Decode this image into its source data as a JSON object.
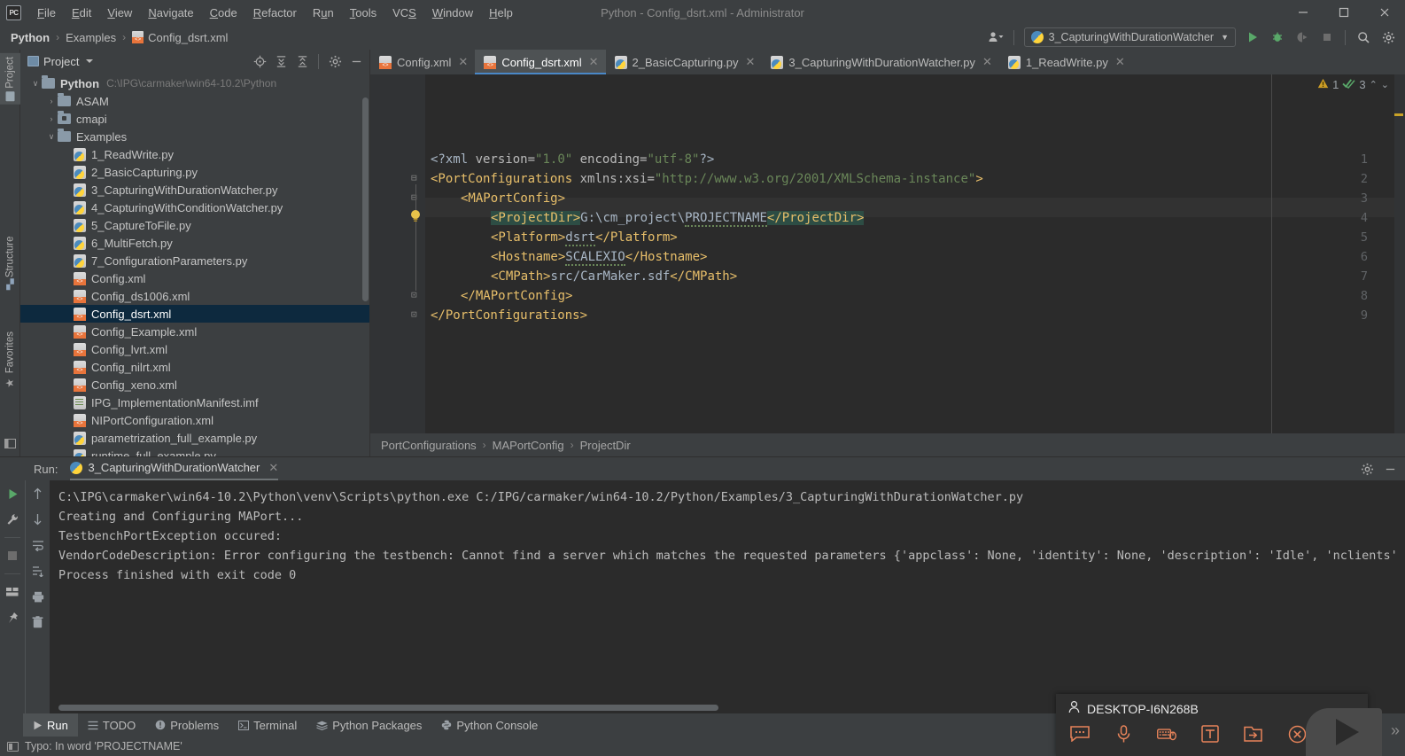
{
  "titlebar": {
    "app_badge": "PC",
    "menus": [
      "File",
      "Edit",
      "View",
      "Navigate",
      "Code",
      "Refactor",
      "Run",
      "Tools",
      "VCS",
      "Window",
      "Help"
    ],
    "window_title": "Python - Config_dsrt.xml - Administrator",
    "minimize": "—",
    "maximize": "☐",
    "close": "✕"
  },
  "navbar": {
    "crumbs": [
      "Python",
      "Examples",
      "Config_dsrt.xml"
    ],
    "separator": "›",
    "run_config": "3_CapturingWithDurationWatcher",
    "profile_icon": "user-profile-icon",
    "run_icon": "run-icon",
    "debug_icon": "debug-icon",
    "coverage_icon": "run-coverage-icon",
    "stop_icon": "stop-icon",
    "search_icon": "search-everywhere-icon",
    "settings_icon": "settings-gear-icon"
  },
  "left_strip": {
    "project": "Project",
    "structure": "Structure",
    "favorites": "Favorites"
  },
  "project_panel": {
    "title": "Project",
    "icons": [
      "locate-icon",
      "expand-all-icon",
      "collapse-all-icon",
      "settings-gear-icon",
      "hide-icon"
    ],
    "tree": [
      {
        "label": "Python",
        "path": "C:\\IPG\\carmaker\\win64-10.2\\Python",
        "type": "folder",
        "indent": 0,
        "arrow": "∨",
        "bold": true,
        "selected": false
      },
      {
        "label": "ASAM",
        "path": "",
        "type": "folder",
        "indent": 1,
        "arrow": "›",
        "bold": false,
        "selected": false
      },
      {
        "label": "cmapi",
        "path": "",
        "type": "folder-module",
        "indent": 1,
        "arrow": "›",
        "bold": false,
        "selected": false
      },
      {
        "label": "Examples",
        "path": "",
        "type": "folder",
        "indent": 1,
        "arrow": "∨",
        "bold": false,
        "selected": false
      },
      {
        "label": "1_ReadWrite.py",
        "path": "",
        "type": "py",
        "indent": 2,
        "arrow": "",
        "bold": false,
        "selected": false
      },
      {
        "label": "2_BasicCapturing.py",
        "path": "",
        "type": "py",
        "indent": 2,
        "arrow": "",
        "bold": false,
        "selected": false
      },
      {
        "label": "3_CapturingWithDurationWatcher.py",
        "path": "",
        "type": "py",
        "indent": 2,
        "arrow": "",
        "bold": false,
        "selected": false
      },
      {
        "label": "4_CapturingWithConditionWatcher.py",
        "path": "",
        "type": "py",
        "indent": 2,
        "arrow": "",
        "bold": false,
        "selected": false
      },
      {
        "label": "5_CaptureToFile.py",
        "path": "",
        "type": "py",
        "indent": 2,
        "arrow": "",
        "bold": false,
        "selected": false
      },
      {
        "label": "6_MultiFetch.py",
        "path": "",
        "type": "py",
        "indent": 2,
        "arrow": "",
        "bold": false,
        "selected": false
      },
      {
        "label": "7_ConfigurationParameters.py",
        "path": "",
        "type": "py",
        "indent": 2,
        "arrow": "",
        "bold": false,
        "selected": false
      },
      {
        "label": "Config.xml",
        "path": "",
        "type": "xml",
        "indent": 2,
        "arrow": "",
        "bold": false,
        "selected": false
      },
      {
        "label": "Config_ds1006.xml",
        "path": "",
        "type": "xml",
        "indent": 2,
        "arrow": "",
        "bold": false,
        "selected": false
      },
      {
        "label": "Config_dsrt.xml",
        "path": "",
        "type": "xml",
        "indent": 2,
        "arrow": "",
        "bold": false,
        "selected": true
      },
      {
        "label": "Config_Example.xml",
        "path": "",
        "type": "xml",
        "indent": 2,
        "arrow": "",
        "bold": false,
        "selected": false
      },
      {
        "label": "Config_lvrt.xml",
        "path": "",
        "type": "xml",
        "indent": 2,
        "arrow": "",
        "bold": false,
        "selected": false
      },
      {
        "label": "Config_nilrt.xml",
        "path": "",
        "type": "xml",
        "indent": 2,
        "arrow": "",
        "bold": false,
        "selected": false
      },
      {
        "label": "Config_xeno.xml",
        "path": "",
        "type": "xml",
        "indent": 2,
        "arrow": "",
        "bold": false,
        "selected": false
      },
      {
        "label": "IPG_ImplementationManifest.imf",
        "path": "",
        "type": "imf",
        "indent": 2,
        "arrow": "",
        "bold": false,
        "selected": false
      },
      {
        "label": "NIPortConfiguration.xml",
        "path": "",
        "type": "xml",
        "indent": 2,
        "arrow": "",
        "bold": false,
        "selected": false
      },
      {
        "label": "parametrization_full_example.py",
        "path": "",
        "type": "py",
        "indent": 2,
        "arrow": "",
        "bold": false,
        "selected": false
      },
      {
        "label": "runtime_full_example.py",
        "path": "",
        "type": "py",
        "indent": 2,
        "arrow": "",
        "bold": false,
        "selected": false
      }
    ]
  },
  "editor_tabs": [
    {
      "label": "Config.xml",
      "type": "xml",
      "active": false
    },
    {
      "label": "Config_dsrt.xml",
      "type": "xml",
      "active": true
    },
    {
      "label": "2_BasicCapturing.py",
      "type": "py",
      "active": false
    },
    {
      "label": "3_CapturingWithDurationWatcher.py",
      "type": "py",
      "active": false
    },
    {
      "label": "1_ReadWrite.py",
      "type": "py",
      "active": false
    }
  ],
  "editor": {
    "line_numbers": [
      "1",
      "2",
      "3",
      "4",
      "5",
      "6",
      "7",
      "8",
      "9"
    ],
    "lines": {
      "l1_decl_open": "<?xml ",
      "l1_attr1": "version",
      "l1_eq": "=",
      "l1_val1": "\"1.0\"",
      "l1_attr2": " encoding",
      "l1_val2": "\"utf-8\"",
      "l1_decl_close": "?>",
      "l2_tag": "<PortConfigurations",
      "l2_attr": " xmlns:xsi=",
      "l2_val": "\"http://www.w3.org/2001/XMLSchema-instance\"",
      "l2_close": ">",
      "l3": "<MAPortConfig>",
      "l4_open": "<ProjectDir>",
      "l4_text1": "G:\\cm_project\\",
      "l4_text2": "PROJECTNAME",
      "l4_close": "</ProjectDir>",
      "l5_open": "<Platform>",
      "l5_text": "dsrt",
      "l5_close": "</Platform>",
      "l6_open": "<Hostname>",
      "l6_text": "SCALEXIO",
      "l6_close": "</Hostname>",
      "l7_open": "<CMPath>",
      "l7_text": "src/CarMaker.sdf",
      "l7_close": "</CMPath>",
      "l8": "</MAPortConfig>",
      "l9": "</PortConfigurations>"
    },
    "inspection": {
      "warning_count": "1",
      "typo_count": "3",
      "up": "⌃",
      "down": "⌄"
    },
    "bulb_icon": "intention-bulb-icon",
    "breadcrumbs": [
      "PortConfigurations",
      "MAPortConfig",
      "ProjectDir"
    ],
    "breadcrumb_sep": "›"
  },
  "run_panel": {
    "label": "Run:",
    "tab_name": "3_CapturingWithDurationWatcher",
    "close": "✕",
    "settings_icon": "settings-gear-icon",
    "hide_icon": "hide-icon",
    "gutter_left": [
      "rerun-icon",
      "settings-wrench-icon",
      "stop-icon",
      "layout-icon",
      "pin-icon"
    ],
    "gutter_right": [
      "up-arrow-icon",
      "down-arrow-icon",
      "soft-wrap-icon",
      "scroll-to-end-icon",
      "print-icon",
      "clear-all-icon"
    ],
    "console_lines": [
      "C:\\IPG\\carmaker\\win64-10.2\\Python\\venv\\Scripts\\python.exe C:/IPG/carmaker/win64-10.2/Python/Examples/3_CapturingWithDurationWatcher.py",
      "Creating and Configuring MAPort...",
      "TestbenchPortException occured:",
      "VendorCodeDescription: Error configuring the testbench: Cannot find a server which matches the requested parameters {'appclass': None, 'identity': None, 'description': 'Idle', 'nclients'",
      "",
      "Process finished with exit code 0"
    ]
  },
  "bottom_bar": {
    "tabs": [
      {
        "label": "Run",
        "icon": "run-icon",
        "active": true
      },
      {
        "label": "TODO",
        "icon": "todo-icon",
        "active": false
      },
      {
        "label": "Problems",
        "icon": "problems-icon",
        "active": false
      },
      {
        "label": "Terminal",
        "icon": "terminal-icon",
        "active": false
      },
      {
        "label": "Python Packages",
        "icon": "packages-icon",
        "active": false
      },
      {
        "label": "Python Console",
        "icon": "python-console-icon",
        "active": false
      }
    ]
  },
  "status_bar": {
    "message": "Typo: In word 'PROJECTNAME'",
    "icon": "status-info-icon"
  },
  "remote_overlay": {
    "user": "DESKTOP-I6N268B",
    "person_icon": "person-icon",
    "icons": [
      "chat-icon",
      "microphone-icon",
      "keyboard-mouse-icon",
      "text-input-icon",
      "file-transfer-icon",
      "disconnect-icon"
    ],
    "expand_chevron": "»"
  },
  "colors": {
    "accent_blue": "#4a88c7",
    "selection_blue": "#0d293e",
    "editor_bg": "#2b2b2b",
    "panel_bg": "#3c3f41",
    "tag_orange": "#e8bf6a",
    "string_green": "#6a8759",
    "text_grey": "#a9b7c6",
    "highlight_teal": "#2d4d44",
    "overlay_orange": "#e8845a",
    "warn_yellow": "#cc9d26",
    "ok_green": "#59a869"
  }
}
